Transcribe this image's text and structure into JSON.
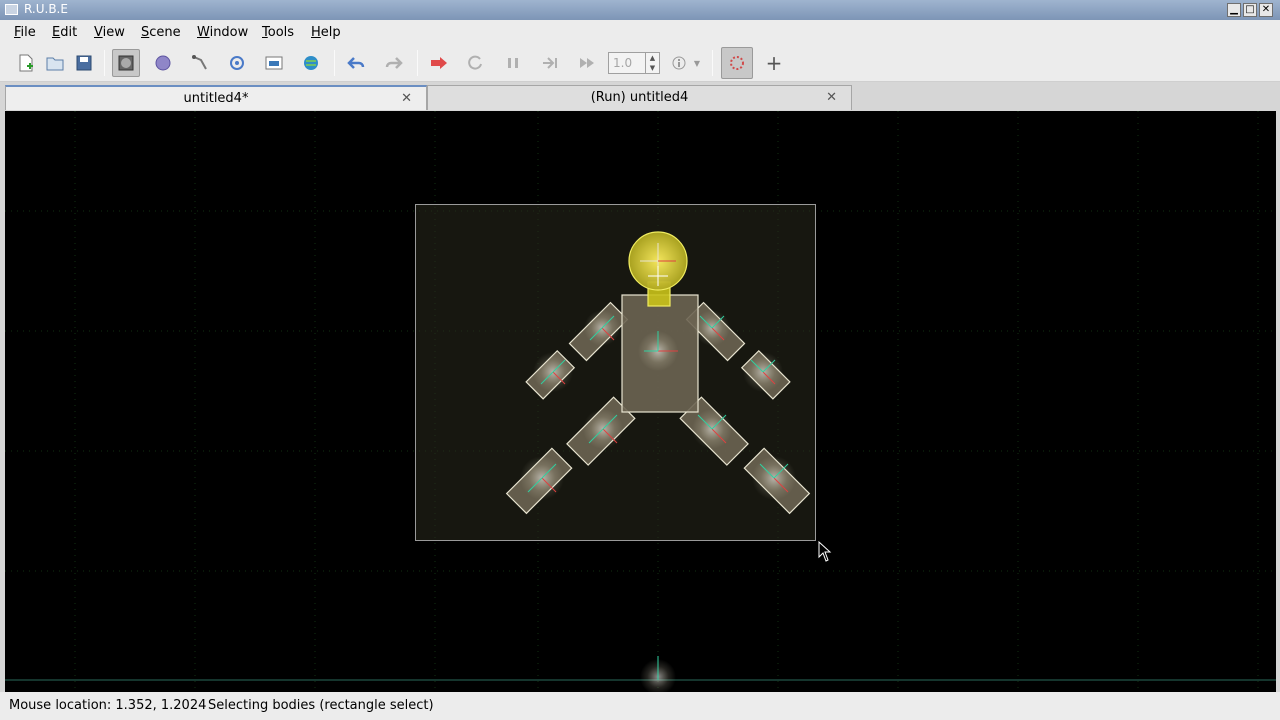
{
  "window": {
    "title": "R.U.B.E"
  },
  "menu": [
    {
      "label": "File",
      "key": "F",
      "rest": "ile"
    },
    {
      "label": "Edit",
      "key": "E",
      "rest": "dit"
    },
    {
      "label": "View",
      "key": "V",
      "rest": "iew"
    },
    {
      "label": "Scene",
      "key": "S",
      "rest": "cene"
    },
    {
      "label": "Window",
      "key": "W",
      "rest": "indow"
    },
    {
      "label": "Tools",
      "key": "T",
      "rest": "ools"
    },
    {
      "label": "Help",
      "key": "H",
      "rest": "elp"
    }
  ],
  "toolbar": {
    "zoom_value": "1.0"
  },
  "tabs": [
    {
      "label": "untitled4*",
      "active": true
    },
    {
      "label": "(Run) untitled4",
      "active": false
    }
  ],
  "status": {
    "mouse_location": "Mouse location: 1.352, 1.2024",
    "mode": "Selecting bodies (rectangle select)"
  },
  "colors": {
    "viewport_bg": "#000000",
    "grid": "#1a2a1a",
    "body_fill": "#6b6452",
    "body_stroke": "#e8e4d0",
    "head_fill": "#c9c21a",
    "selection": "#ffffff",
    "axis_x": "#e04040",
    "axis_y": "#30d0a0"
  }
}
